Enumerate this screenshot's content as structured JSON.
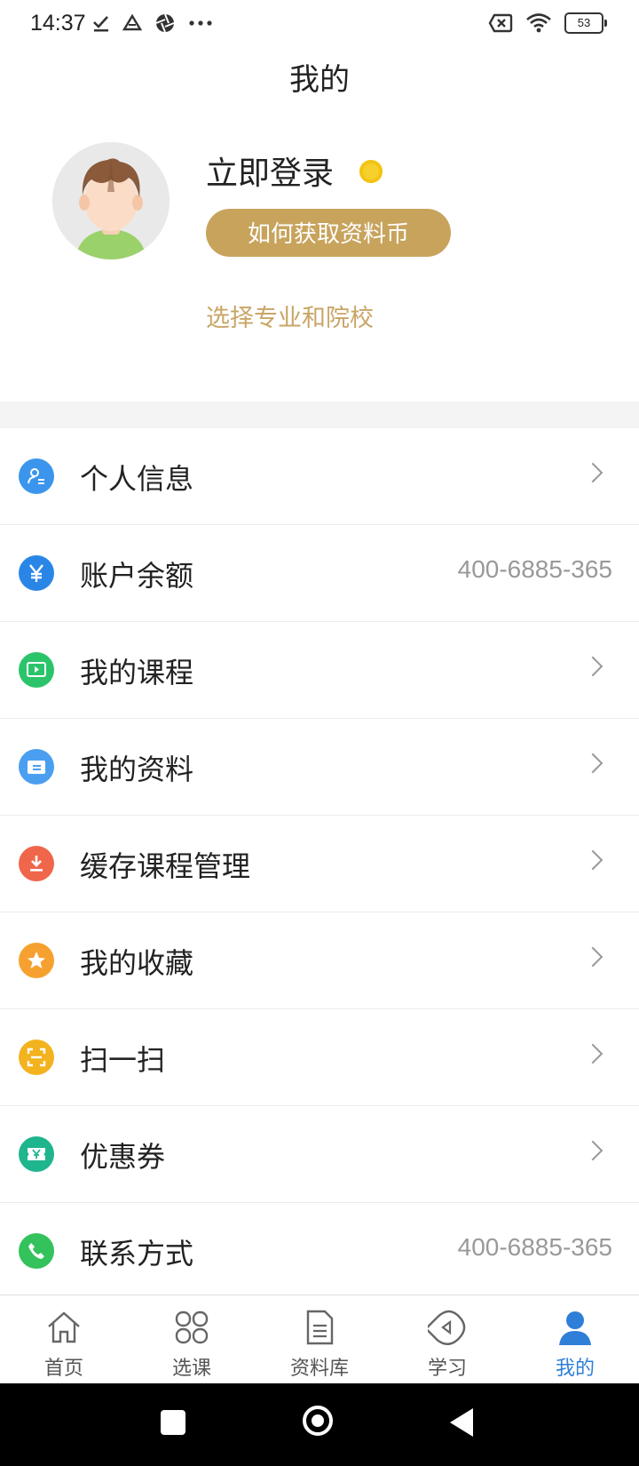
{
  "status_bar": {
    "time": "14:37",
    "battery": "53",
    "icons_left": [
      "download-done-icon",
      "drive-icon",
      "aperture-icon",
      "more-dots-icon"
    ],
    "icons_right": [
      "no-sim-icon",
      "wifi-icon",
      "battery-icon"
    ]
  },
  "header": {
    "title": "我的"
  },
  "profile": {
    "login_label": "立即登录",
    "coin_button": "如何获取资料币",
    "select_major": "选择专业和院校"
  },
  "menu": {
    "items": [
      {
        "label": "个人信息",
        "icon": "user-info-icon",
        "color": "#3b95ec",
        "value": ""
      },
      {
        "label": "账户余额",
        "icon": "yuan-icon",
        "color": "#2a86e6",
        "value": "400-6885-365"
      },
      {
        "label": "我的课程",
        "icon": "video-play-icon",
        "color": "#2cc46b",
        "value": ""
      },
      {
        "label": "我的资料",
        "icon": "folder-doc-icon",
        "color": "#4a9ff0",
        "value": ""
      },
      {
        "label": "缓存课程管理",
        "icon": "download-icon",
        "color": "#f0664a",
        "value": ""
      },
      {
        "label": "我的收藏",
        "icon": "star-icon",
        "color": "#f6a12f",
        "value": ""
      },
      {
        "label": "扫一扫",
        "icon": "scan-icon",
        "color": "#f3b31f",
        "value": ""
      },
      {
        "label": "优惠券",
        "icon": "coupon-icon",
        "color": "#1fb58d",
        "value": ""
      },
      {
        "label": "联系方式",
        "icon": "phone-icon",
        "color": "#33c25b",
        "value": "400-6885-365"
      }
    ]
  },
  "tabbar": {
    "tabs": [
      {
        "label": "首页",
        "icon": "home-icon"
      },
      {
        "label": "选课",
        "icon": "grid-icon"
      },
      {
        "label": "资料库",
        "icon": "document-icon"
      },
      {
        "label": "学习",
        "icon": "play-circle-icon"
      },
      {
        "label": "我的",
        "icon": "person-icon",
        "active": true
      }
    ]
  },
  "colors": {
    "accent_gold": "#c7a35c",
    "active_blue": "#2f7fd8"
  }
}
